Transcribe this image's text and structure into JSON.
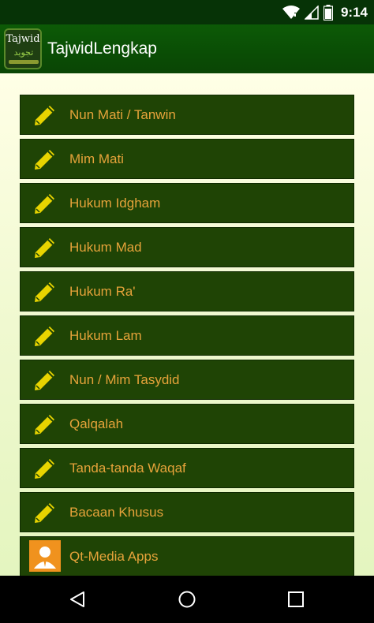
{
  "status_bar": {
    "time": "9:14"
  },
  "app_bar": {
    "title": "TajwidLengkap",
    "logo_text": "Tajwid",
    "logo_arabic": "تجويد"
  },
  "menu": {
    "items": [
      {
        "label": "Nun Mati / Tanwin",
        "icon": "pencil-icon"
      },
      {
        "label": "Mim Mati",
        "icon": "pencil-icon"
      },
      {
        "label": "Hukum Idgham",
        "icon": "pencil-icon"
      },
      {
        "label": "Hukum Mad",
        "icon": "pencil-icon"
      },
      {
        "label": "Hukum Ra'",
        "icon": "pencil-icon"
      },
      {
        "label": "Hukum Lam",
        "icon": "pencil-icon"
      },
      {
        "label": "Nun / Mim Tasydid",
        "icon": "pencil-icon"
      },
      {
        "label": "Qalqalah",
        "icon": "pencil-icon"
      },
      {
        "label": "Tanda-tanda Waqaf",
        "icon": "pencil-icon"
      },
      {
        "label": "Bacaan Khusus",
        "icon": "pencil-icon"
      },
      {
        "label": "Qt-Media Apps",
        "icon": "person-app-icon"
      }
    ]
  },
  "colors": {
    "status_bar_bg": "#063306",
    "app_bar_bg": "#0a4d05",
    "menu_item_bg": "#1f4405",
    "menu_text": "#e6a33a",
    "pencil_icon": "#e8d400",
    "content_bg": "#f0f9d0",
    "app_icon_bg": "#f0921e"
  }
}
